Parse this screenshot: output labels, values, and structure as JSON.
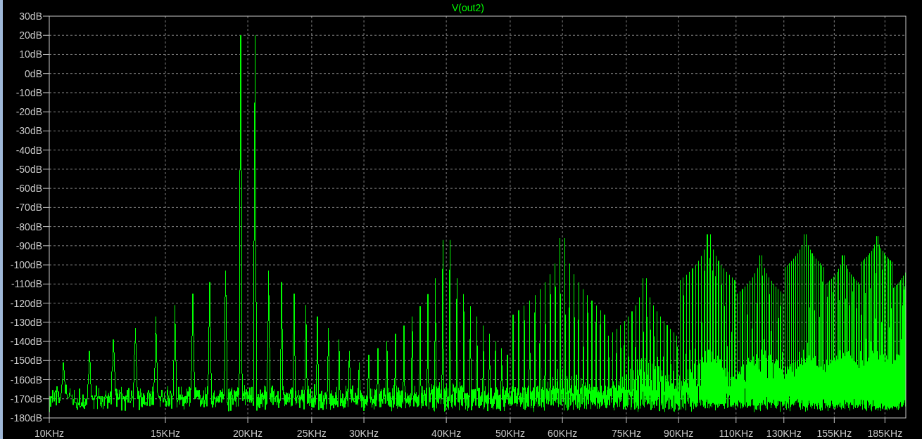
{
  "plot": {
    "title": "V(out2)",
    "y_ticks": [
      "30dB",
      "20dB",
      "10dB",
      "0dB",
      "-10dB",
      "-20dB",
      "-30dB",
      "-40dB",
      "-50dB",
      "-60dB",
      "-70dB",
      "-80dB",
      "-90dB",
      "-100dB",
      "-110dB",
      "-120dB",
      "-130dB",
      "-140dB",
      "-150dB",
      "-160dB",
      "-170dB",
      "-180dB"
    ],
    "x_ticks": [
      "10KHz",
      "15KHz",
      "20KHz",
      "25KHz",
      "30KHz",
      "40KHz",
      "50KHz",
      "60KHz",
      "75KHz",
      "90KHz",
      "110KHz",
      "130KHz",
      "155KHz",
      "185KHz"
    ]
  }
}
